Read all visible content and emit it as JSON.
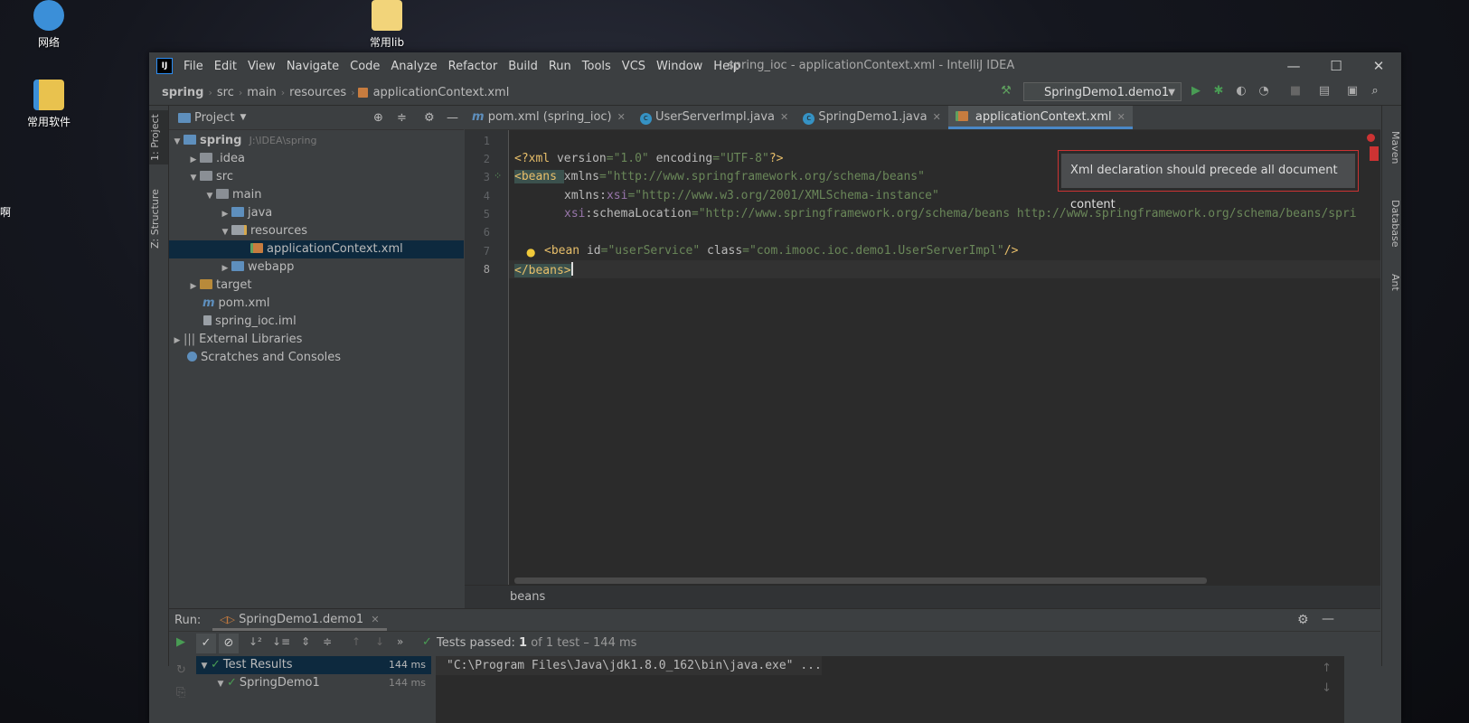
{
  "desktop": {
    "icons": [
      {
        "label": "网络"
      },
      {
        "label": "常用lib"
      },
      {
        "label": "常用软件"
      }
    ],
    "edge_text": "啊"
  },
  "window": {
    "title": "spring_ioc - applicationContext.xml - IntelliJ IDEA",
    "logo": "IJ",
    "menu": [
      "File",
      "Edit",
      "View",
      "Navigate",
      "Code",
      "Analyze",
      "Refactor",
      "Build",
      "Run",
      "Tools",
      "VCS",
      "Window",
      "Help"
    ],
    "controls": {
      "minimize": "—",
      "maximize": "☐",
      "close": "✕"
    }
  },
  "navbar": {
    "crumbs": [
      "spring",
      "src",
      "main",
      "resources",
      "applicationContext.xml"
    ],
    "run_config": "SpringDemo1.demo1"
  },
  "left_strip": {
    "project_tab": "1: Project",
    "structure_tab": "Z: Structure"
  },
  "right_strip": {
    "maven": "Maven",
    "database": "Database",
    "ant": "Ant"
  },
  "project_panel": {
    "title": "Project",
    "tree": [
      {
        "label": "spring",
        "hint": "J:\\IDEA\\spring"
      },
      {
        "label": ".idea"
      },
      {
        "label": "src"
      },
      {
        "label": "main"
      },
      {
        "label": "java"
      },
      {
        "label": "resources"
      },
      {
        "label": "applicationContext.xml"
      },
      {
        "label": "webapp"
      },
      {
        "label": "target"
      },
      {
        "label": "pom.xml"
      },
      {
        "label": "spring_ioc.iml"
      },
      {
        "label": "External Libraries"
      },
      {
        "label": "Scratches and Consoles"
      }
    ]
  },
  "editor_tabs": [
    {
      "label": "pom.xml (spring_ioc)"
    },
    {
      "label": "UserServerImpl.java"
    },
    {
      "label": "SpringDemo1.java"
    },
    {
      "label": "applicationContext.xml"
    }
  ],
  "editor": {
    "line_numbers": [
      "1",
      "2",
      "3",
      "4",
      "5",
      "6",
      "7",
      "8"
    ],
    "lines": {
      "l2_decl_open": "<?xml ",
      "l2_a1": "version",
      "l2_v1": "=\"1.0\" ",
      "l2_a2": "encoding",
      "l2_v2": "=\"UTF-8\"",
      "l2_close": "?>",
      "l3_tag": "<beans ",
      "l3_attr": "xmlns",
      "l3_val": "=\"http://www.springframework.org/schema/beans\"",
      "l4_attr": "xmlns:",
      "l4_ns": "xsi",
      "l4_val": "=\"http://www.w3.org/2001/XMLSchema-instance\"",
      "l5_ns": "xsi",
      "l5_attr": ":schemaLocation",
      "l5_val": "=\"http://www.springframework.org/schema/beans http://www.springframework.org/schema/beans/spri",
      "l7_tag": "<bean ",
      "l7_a1": "id",
      "l7_v1": "=\"userService\" ",
      "l7_a2": "class",
      "l7_v2": "=\"com.imooc.ioc.demo1.UserServerImpl\"",
      "l7_close": "/>",
      "l8_tag": "</beans>"
    },
    "tooltip": "Xml declaration should precede all document content",
    "breadcrumb": "beans"
  },
  "run_panel": {
    "label": "Run:",
    "config": "SpringDemo1.demo1",
    "status_prefix": "Tests passed: ",
    "status_count": "1",
    "status_suffix": " of 1 test – 144 ms",
    "tree": [
      {
        "label": "Test Results",
        "time": "144 ms"
      },
      {
        "label": "SpringDemo1",
        "time": "144 ms"
      }
    ],
    "console_line": "\"C:\\Program Files\\Java\\jdk1.8.0_162\\bin\\java.exe\" ..."
  },
  "colors": {
    "accent": "#4a88c7",
    "error": "#cc3333",
    "run_green": "#499c54"
  }
}
